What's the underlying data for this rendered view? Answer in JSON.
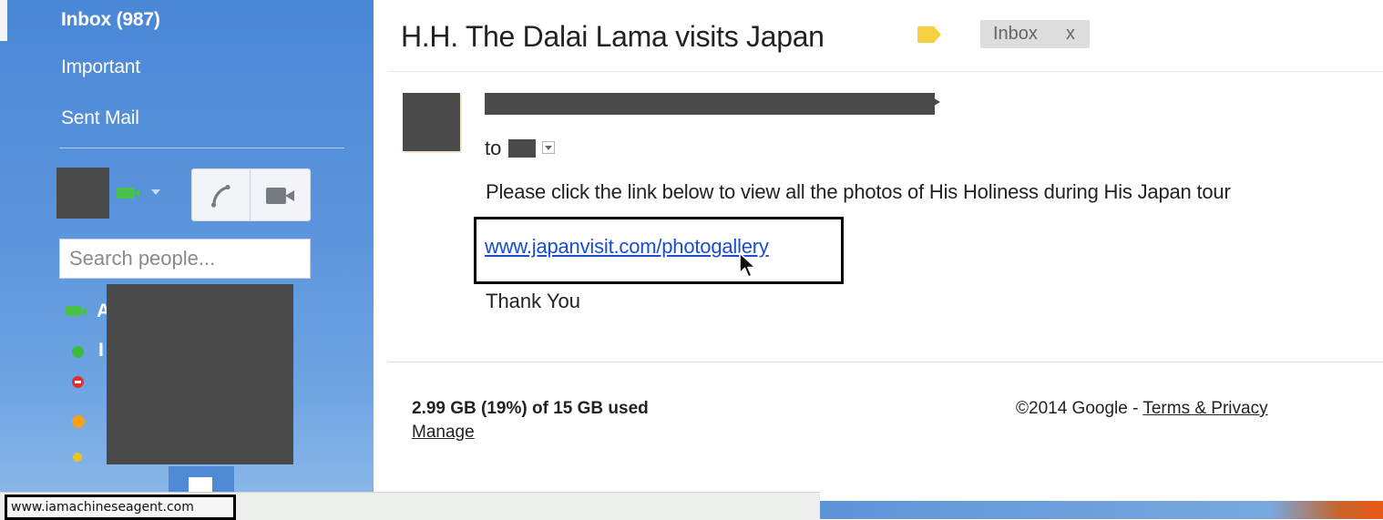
{
  "sidebar": {
    "nav": {
      "inbox": "Inbox (987)",
      "important": "Important",
      "sent": "Sent Mail"
    },
    "search_placeholder": "Search people...",
    "contacts_initials": [
      "A",
      "I"
    ]
  },
  "email": {
    "subject": "H.H. The Dalai Lama visits Japan",
    "label_chip": "Inbox",
    "label_chip_close": "x",
    "to_prefix": "to",
    "body": "Please click the link below to view all the photos of His Holiness during His Japan tour",
    "link_text": "www.japanvisit.com/photogallery",
    "closing": "Thank You"
  },
  "footer": {
    "storage": "2.99 GB (19%) of 15 GB used",
    "manage": "Manage",
    "copyright": "©2014 Google - ",
    "terms": "Terms & Privacy"
  },
  "status_bar": {
    "hover_url": "www.iamachineseagent.com"
  },
  "colors": {
    "sidebar_blue": "#4a87d6",
    "link_blue": "#1a4ecf",
    "label_yellow": "#f7d041",
    "online_green": "#3cba3f",
    "busy_red": "#e0312b",
    "idle_orange": "#f3a11b"
  },
  "icons": [
    "video-camera-icon",
    "phone-icon",
    "chevron-down-icon",
    "label-tag-icon",
    "mouse-pointer-icon",
    "status-dot-icon"
  ]
}
